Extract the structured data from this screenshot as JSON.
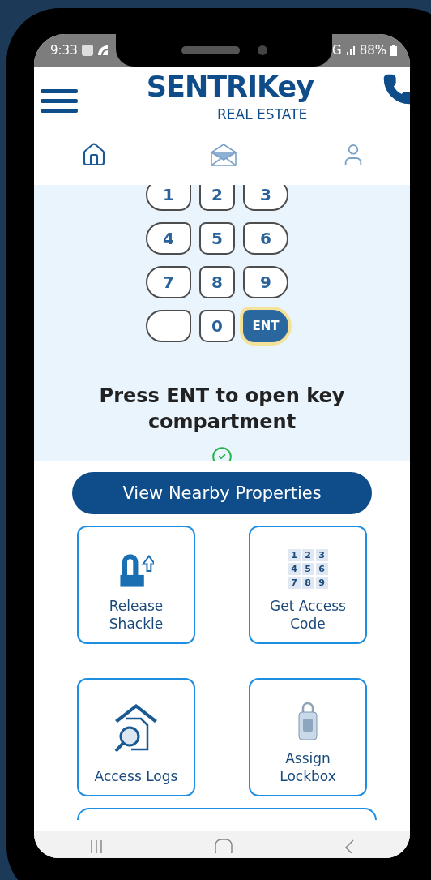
{
  "status_bar": {
    "time": "9:33",
    "network": "G",
    "battery": "88%"
  },
  "header": {
    "logo": "SENTRIKey",
    "subtitle": "REAL ESTATE"
  },
  "tabs": [
    {
      "selected": true
    },
    {
      "selected": false
    },
    {
      "selected": false
    }
  ],
  "keypad": {
    "keys": [
      {
        "kind": "digit",
        "label": "1",
        "highlighted": false
      },
      {
        "kind": "digit",
        "label": "2",
        "highlighted": false
      },
      {
        "kind": "digit",
        "label": "3",
        "highlighted": false
      },
      {
        "kind": "digit",
        "label": "4",
        "highlighted": false
      },
      {
        "kind": "digit",
        "label": "5",
        "highlighted": false
      },
      {
        "kind": "digit",
        "label": "6",
        "highlighted": false
      },
      {
        "kind": "digit",
        "label": "7",
        "highlighted": false
      },
      {
        "kind": "digit",
        "label": "8",
        "highlighted": false
      },
      {
        "kind": "digit",
        "label": "9",
        "highlighted": false
      },
      {
        "kind": "blank",
        "highlighted": false
      },
      {
        "kind": "digit",
        "label": "0",
        "highlighted": false
      },
      {
        "kind": "digit",
        "label": "ENT",
        "highlighted": true
      }
    ],
    "message": "Press ENT to open key compartment",
    "confirmed": true
  },
  "primary_button": "View Nearby Properties",
  "tiles": [
    {
      "kind": "shackle",
      "label": "Release Shackle"
    },
    {
      "kind": "keypad",
      "label": "Get Access Code",
      "digits": [
        "1",
        "2",
        "3",
        "4",
        "5",
        "6",
        "7",
        "8",
        "9"
      ]
    },
    {
      "kind": "logs",
      "label": "Access Logs"
    },
    {
      "kind": "lockbox",
      "label": "Assign Lockbox"
    },
    {
      "kind": "partial"
    }
  ]
}
